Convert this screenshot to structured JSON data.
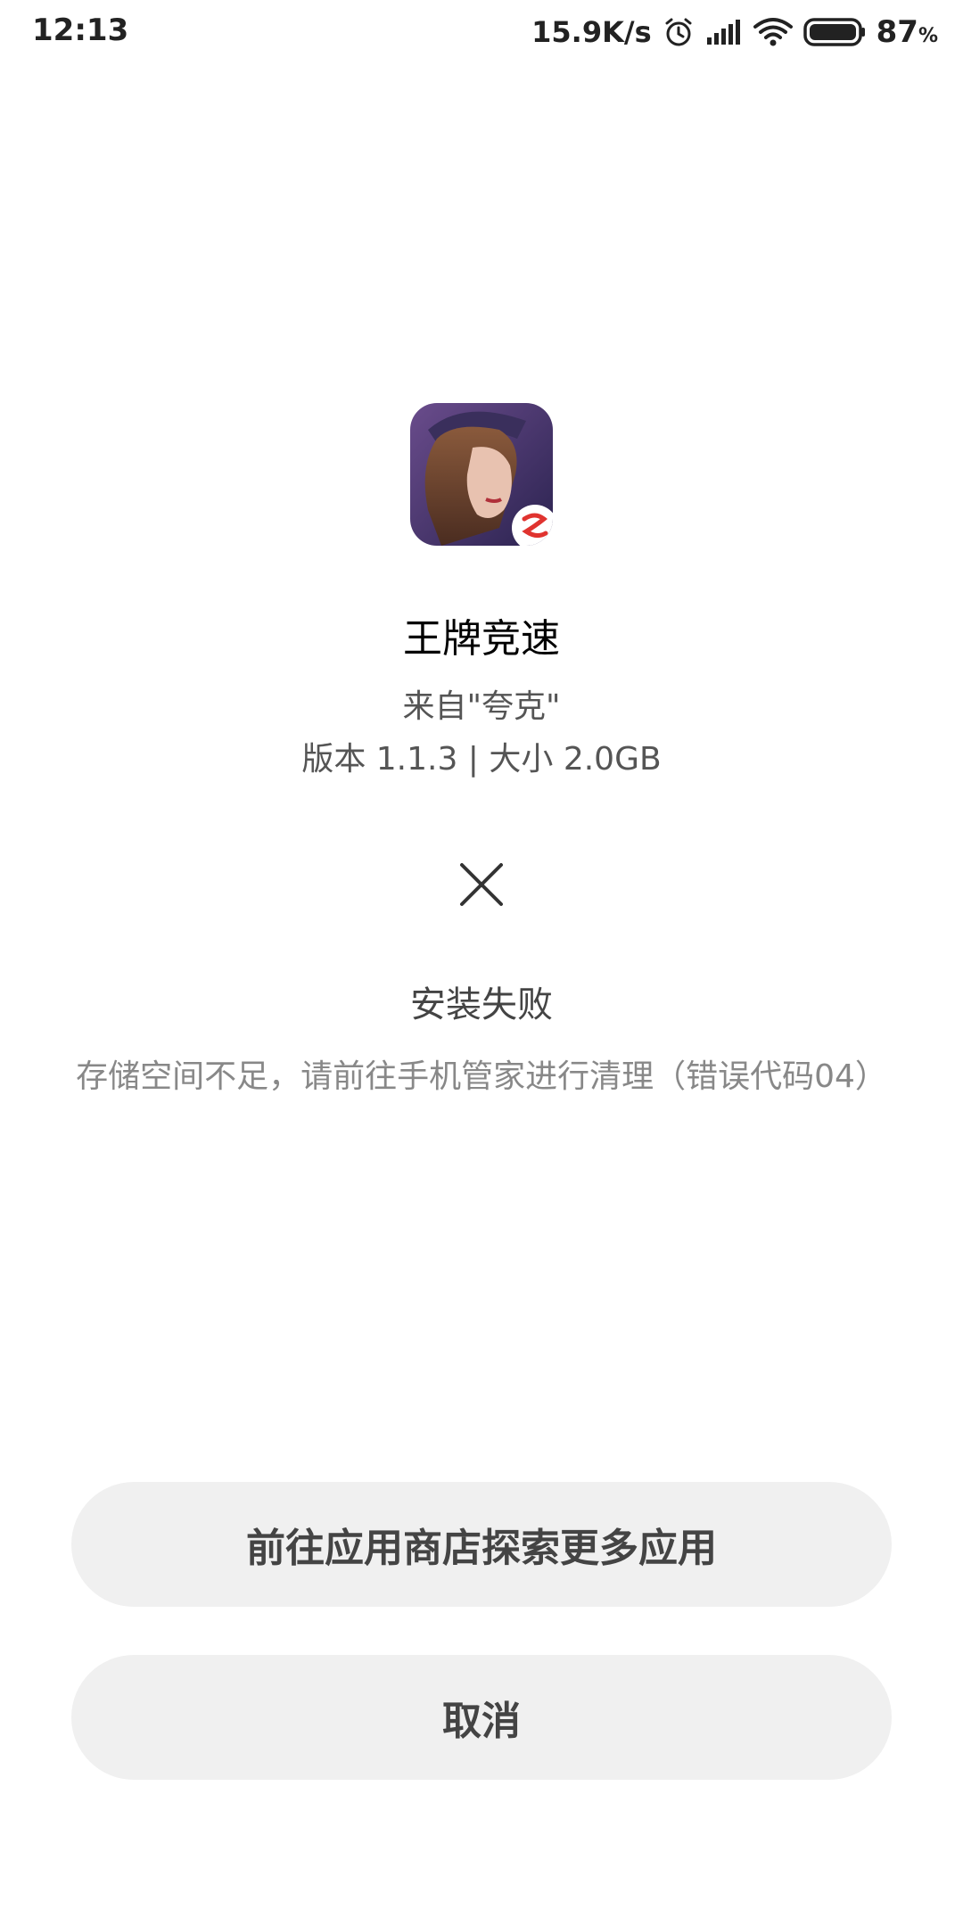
{
  "status_bar": {
    "time": "12:13",
    "net_speed": "15.9K/s",
    "battery_percent": "87",
    "battery_unit": "%",
    "icons": [
      "alarm-icon",
      "signal-icon",
      "wifi-icon",
      "battery-icon"
    ]
  },
  "app": {
    "icon": "app-icon-game-character",
    "name": "王牌竞速",
    "source": "来自\"夸克\"",
    "version_size": "版本 1.1.3 | 大小 2.0GB"
  },
  "result": {
    "icon": "close-x-icon",
    "title": "安装失败",
    "detail": "存储空间不足，请前往手机管家进行清理（错误代码04）"
  },
  "buttons": {
    "store_label": "前往应用商店探索更多应用",
    "cancel_label": "取消"
  },
  "colors": {
    "button_bg": "#f0f0f0",
    "button_text": "#444444",
    "secondary_text": "#555555",
    "detail_text": "#888888",
    "app_badge": "#e0332f"
  }
}
